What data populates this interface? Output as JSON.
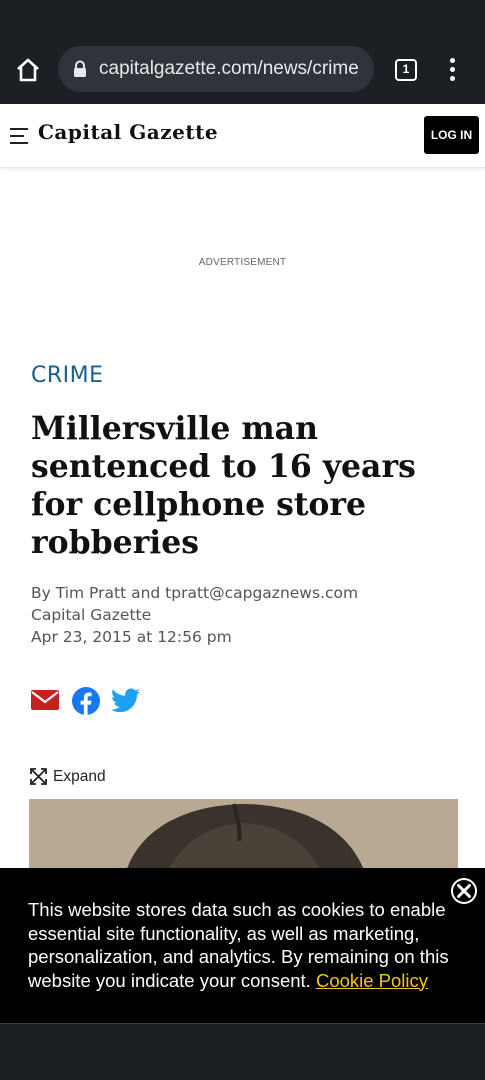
{
  "browser": {
    "url": "capitalgazette.com/news/crime",
    "tab_count": "1",
    "home_icon": "home-icon",
    "lock_icon": "lock-icon",
    "menu_icon": "more-vert-icon"
  },
  "header": {
    "logo": "Capital Gazette",
    "login_label": "LOG IN"
  },
  "ad": {
    "label": "ADVERTISEMENT"
  },
  "article": {
    "section": "CRIME",
    "headline": "Millersville man sentenced to 16 years for cellphone store robberies",
    "byline": "By Tim Pratt and tpratt@capgaznews.com",
    "source": "Capital Gazette",
    "date": "Apr 23, 2015 at 12:56 pm",
    "expand_label": "Expand"
  },
  "share": {
    "email_icon": "email-icon",
    "facebook_icon": "facebook-icon",
    "twitter_icon": "twitter-icon"
  },
  "cookie": {
    "text": "This website stores data such as cookies to enable essential site functionality, as well as marketing, personalization, and analytics. By remaining on this website you indicate your consent. ",
    "link": "Cookie Policy"
  },
  "colors": {
    "section": "#1b5e8a",
    "email": "#c6201f",
    "facebook": "#1877f2",
    "twitter": "#1da1f2",
    "cookie_link": "#f5c518"
  }
}
